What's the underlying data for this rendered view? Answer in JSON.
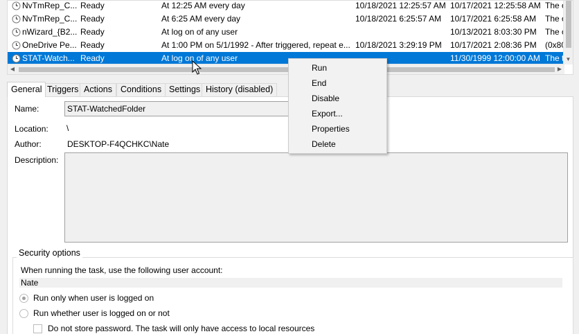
{
  "task_rows": [
    {
      "name": "NvTmRep_C...",
      "status": "Ready",
      "trigger": "At 12:25 AM every day",
      "next_run": "10/18/2021 12:25:57 AM",
      "last_run": "10/17/2021 12:25:58 AM",
      "result": "The o",
      "selected": false
    },
    {
      "name": "NvTmRep_C...",
      "status": "Ready",
      "trigger": "At 6:25 AM every day",
      "next_run": "10/18/2021 6:25:57 AM",
      "last_run": "10/17/2021 6:25:58 AM",
      "result": "The o",
      "selected": false
    },
    {
      "name": "nWizard_{B2...",
      "status": "Ready",
      "trigger": "At log on of any user",
      "next_run": "",
      "last_run": "10/13/2021 8:03:30 PM",
      "result": "The o",
      "selected": false
    },
    {
      "name": "OneDrive Pe...",
      "status": "Ready",
      "trigger": "At 1:00 PM on 5/1/1992 - After triggered, repeat e...",
      "next_run": "10/18/2021 3:29:19 PM",
      "last_run": "10/17/2021 2:08:36 PM",
      "result": "(0x80",
      "selected": false
    },
    {
      "name": "STAT-Watch...",
      "status": "Ready",
      "trigger": "At log on of any user",
      "next_run": "",
      "last_run": "11/30/1999 12:00:00 AM",
      "result": "The t",
      "selected": true
    }
  ],
  "tabs": [
    {
      "label": "General",
      "active": true
    },
    {
      "label": "Triggers",
      "active": false
    },
    {
      "label": "Actions",
      "active": false
    },
    {
      "label": "Conditions",
      "active": false
    },
    {
      "label": "Settings",
      "active": false
    },
    {
      "label": "History (disabled)",
      "active": false
    }
  ],
  "general": {
    "name_label": "Name:",
    "name_value": "STAT-WatchedFolder",
    "location_label": "Location:",
    "location_value": "\\",
    "author_label": "Author:",
    "author_value": "DESKTOP-F4QCHKC\\Nate",
    "description_label": "Description:",
    "description_value": ""
  },
  "security": {
    "title": "Security options",
    "account_prompt": "When running the task, use the following user account:",
    "account_value": "Nate",
    "radio_logged_on": "Run only when user is logged on",
    "radio_whether": "Run whether user is logged on or not",
    "no_store_password": "Do not store password.  The task will only have access to local resources"
  },
  "context_menu": {
    "items": [
      "Run",
      "End",
      "Disable",
      "Export...",
      "Properties",
      "Delete"
    ]
  },
  "icons": {
    "task": "clock-task-icon",
    "cursor": "mouse-pointer-icon"
  },
  "colors": {
    "selection": "#0078d7",
    "menu_bg": "#f2f2f2"
  }
}
